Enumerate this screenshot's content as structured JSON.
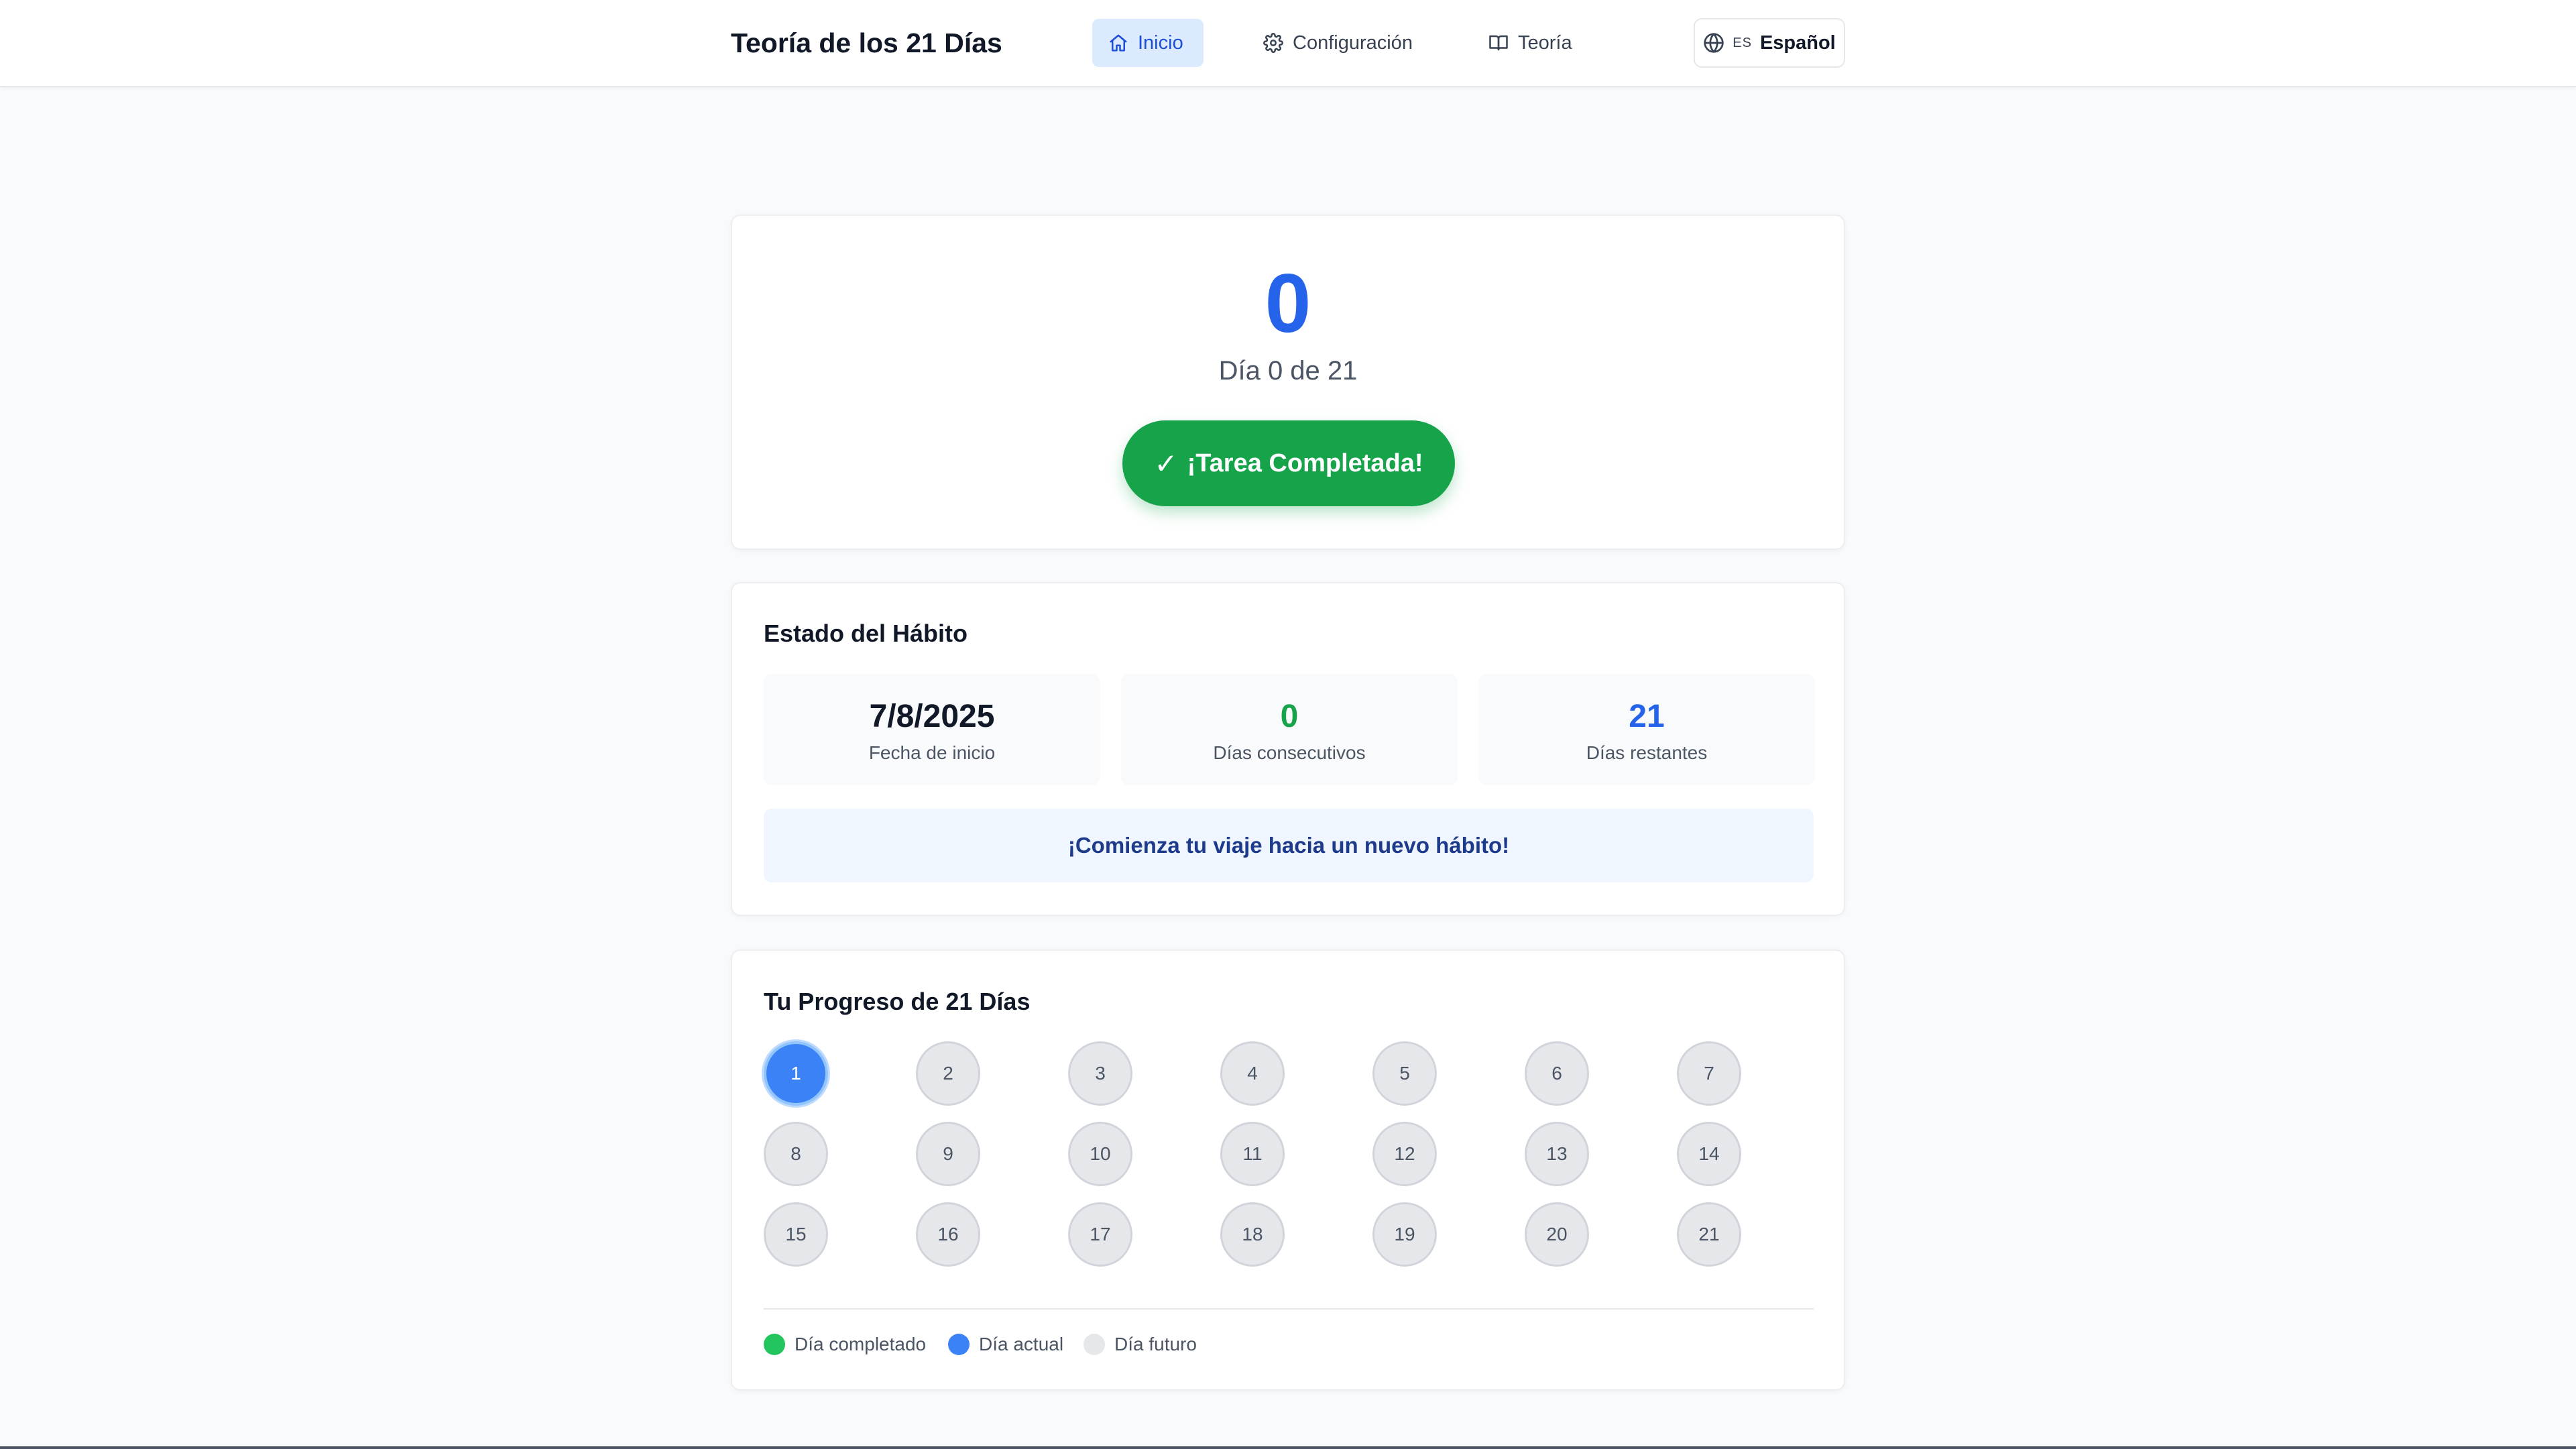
{
  "app": {
    "title": "Teoría de los 21 Días"
  },
  "nav": {
    "items": [
      {
        "label": "Inicio",
        "icon": "home-icon",
        "active": true
      },
      {
        "label": "Configuración",
        "icon": "gear-icon",
        "active": false
      },
      {
        "label": "Teoría",
        "icon": "book-icon",
        "active": false
      }
    ],
    "language": {
      "code": "ES",
      "label": "Español",
      "icon": "globe-icon"
    }
  },
  "counter": {
    "value": "0",
    "day_text": "Día 0 de 21",
    "complete_button": "¡Tarea Completada!",
    "complete_icon": "✓"
  },
  "status": {
    "title": "Estado del Hábito",
    "stats": [
      {
        "value": "7/8/2025",
        "label": "Fecha de inicio"
      },
      {
        "value": "0",
        "label": "Días consecutivos"
      },
      {
        "value": "21",
        "label": "Días restantes"
      }
    ],
    "message": "¡Comienza tu viaje hacia un nuevo hábito!"
  },
  "progress": {
    "title": "Tu Progreso de 21 Días",
    "total_days": 21,
    "current_day": 1,
    "completed_days": 0,
    "days": [
      "1",
      "2",
      "3",
      "4",
      "5",
      "6",
      "7",
      "8",
      "9",
      "10",
      "11",
      "12",
      "13",
      "14",
      "15",
      "16",
      "17",
      "18",
      "19",
      "20",
      "21"
    ],
    "legend": [
      {
        "label": "Día completado",
        "color": "#22c55e"
      },
      {
        "label": "Día actual",
        "color": "#3b82f6"
      },
      {
        "label": "Día futuro",
        "color": "#e5e7eb"
      }
    ]
  },
  "colors": {
    "primary": "#2563eb",
    "success": "#16a34a",
    "nav_active_bg": "#dbeafe"
  }
}
